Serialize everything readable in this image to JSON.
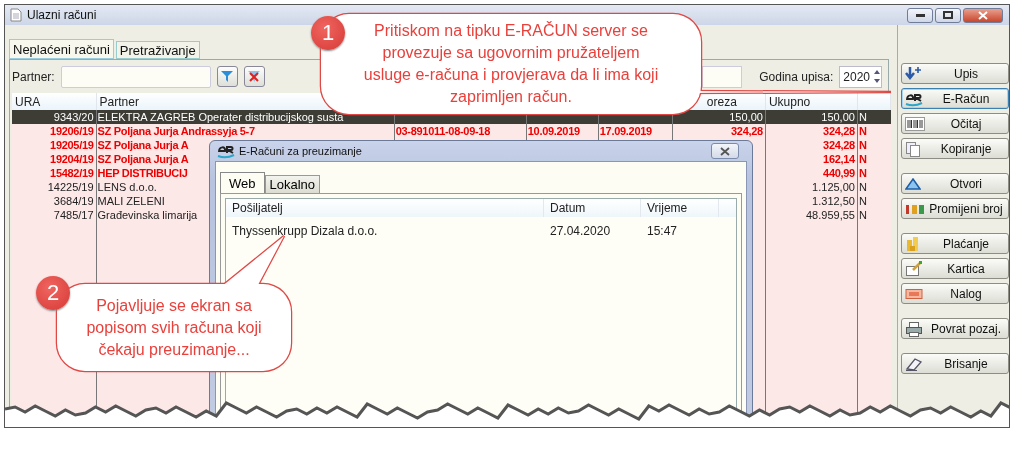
{
  "window": {
    "title": "Ulazni računi"
  },
  "tabs": [
    {
      "label": "Neplaćeni računi",
      "selected": true
    },
    {
      "label": "Pretraživanje",
      "selected": false
    }
  ],
  "filter": {
    "label": "Partner:"
  },
  "year": {
    "label": "Godina upisa:",
    "value": "2020"
  },
  "table": {
    "headers": {
      "ura": "URA",
      "partner": "Partner",
      "column_6": "oreza",
      "ukupno": "Ukupno"
    },
    "rows": [
      {
        "ura": "9343/20",
        "partner": "ELEKTRA ZAGREB Operater distribucijskog susta",
        "column_6": "150,00",
        "ukupno": "150,00",
        "column_8": "N",
        "selected": true,
        "overdue": false
      },
      {
        "ura": "19206/19",
        "partner": "SZ Poljana Jurja Andrassyja 5-7",
        "column_3": "03-891011-08-09-18",
        "column_4": "10.09.2019",
        "column_5": "17.09.2019",
        "column_6": "324,28",
        "ukupno": "324,28",
        "column_8": "N",
        "selected": false,
        "overdue": true
      },
      {
        "ura": "19205/19",
        "partner": "SZ Poljana Jurja A",
        "ukupno": "324,28",
        "column_8": "N",
        "selected": false,
        "overdue": true
      },
      {
        "ura": "19204/19",
        "partner": "SZ Poljana Jurja A",
        "ukupno": "162,14",
        "column_8": "N",
        "selected": false,
        "overdue": true
      },
      {
        "ura": "15482/19",
        "partner": "HEP DISTRIBUCIJ",
        "ukupno": "440,99",
        "column_8": "N",
        "selected": false,
        "overdue": true
      },
      {
        "ura": "14225/19",
        "partner": "LENS d.o.o.",
        "ukupno": "1.125,00",
        "column_8": "N",
        "selected": false,
        "overdue": false
      },
      {
        "ura": "3684/19",
        "partner": "MALI ZELENI",
        "ukupno": "1.312,50",
        "column_8": "N",
        "selected": false,
        "overdue": false
      },
      {
        "ura": "7485/17",
        "partner": "Građevinska limarija",
        "ukupno": "48.959,55",
        "column_8": "N",
        "selected": false,
        "overdue": false
      }
    ]
  },
  "button_groups": [
    {
      "buttons": [
        {
          "label": "Upis",
          "focused": false
        },
        {
          "label": "E-Račun",
          "focused": true
        },
        {
          "label": "Očitaj",
          "focused": false
        },
        {
          "label": "Kopiranje",
          "focused": false
        }
      ]
    },
    {
      "buttons": [
        {
          "label": "Otvori",
          "focused": false
        },
        {
          "label": "Promijeni broj",
          "focused": false
        }
      ]
    },
    {
      "buttons": [
        {
          "label": "Plaćanje",
          "focused": false
        },
        {
          "label": "Kartica",
          "focused": false
        },
        {
          "label": "Nalog",
          "focused": false
        }
      ]
    },
    {
      "buttons": [
        {
          "label": "Povrat pozaj.",
          "focused": false
        }
      ]
    },
    {
      "buttons": [
        {
          "label": "Brisanje",
          "focused": false
        }
      ]
    }
  ],
  "dialog": {
    "title": "E-Računi za preuzimanje",
    "tabs": [
      {
        "label": "Web",
        "selected": true
      },
      {
        "label": "Lokalno",
        "selected": false
      }
    ],
    "columns": [
      "Pošiljatelj",
      "Datum",
      "Vrijeme"
    ],
    "rows": [
      {
        "sender": "Thyssenkrupp Dizala d.o.o.",
        "date": "27.04.2020",
        "time": "15:47"
      }
    ]
  },
  "callouts": [
    {
      "number": "1",
      "text": "Pritiskom na tipku E-RAČUN server se provezuje sa ugovornim pružateljem usluge e-računa i provjerava da li ima koji zaprimljen račun."
    },
    {
      "number": "2",
      "text": "Pojavljuje se ekran sa popisom svih računa koji čekaju preuzimanje..."
    }
  ]
}
